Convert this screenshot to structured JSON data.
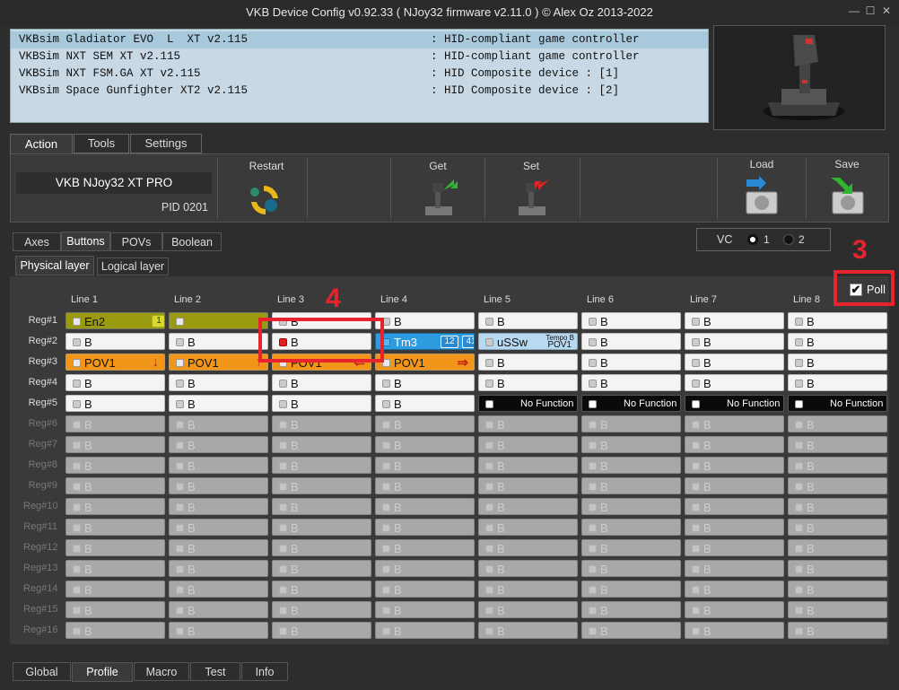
{
  "window": {
    "title": "VKB Device Config v0.92.33 ( NJoy32 firmware v2.11.0 ) © Alex Oz 2013-2022",
    "minimize": "—",
    "maximize": "☐",
    "close": "✕"
  },
  "devices": [
    {
      "name": "VKBsim Gladiator EVO  L  XT v2.115",
      "desc": ": HID-compliant game controller"
    },
    {
      "name": "VKBSim NXT SEM XT v2.115",
      "desc": ": HID-compliant game controller"
    },
    {
      "name": "VKBSim NXT FSM.GA XT v2.115",
      "desc": ": HID Composite device : [1]"
    },
    {
      "name": "VKBsim Space Gunfighter XT2 v2.115",
      "desc": ": HID Composite device : [2]"
    }
  ],
  "main_tabs": [
    "Action",
    "Tools",
    "Settings"
  ],
  "action": {
    "device_name": "VKB NJoy32 XT PRO",
    "pid": "PID 0201",
    "restart": "Restart",
    "get": "Get",
    "set": "Set",
    "load": "Load",
    "save": "Save"
  },
  "sub_tabs": [
    "Axes",
    "Buttons",
    "POVs",
    "Boolean"
  ],
  "vc": {
    "label": "VC",
    "opt1": "1",
    "opt2": "2",
    "selected": "1"
  },
  "layer_tabs": [
    "Physical layer",
    "Logical layer"
  ],
  "poll": {
    "label": "Poll",
    "checked": true
  },
  "lines": [
    "Line 1",
    "Line 2",
    "Line 3",
    "Line 4",
    "Line 5",
    "Line 6",
    "Line 7",
    "Line 8"
  ],
  "regs": [
    "Reg#1",
    "Reg#2",
    "Reg#3",
    "Reg#4",
    "Reg#5",
    "Reg#6",
    "Reg#7",
    "Reg#8",
    "Reg#9",
    "Reg#10",
    "Reg#11",
    "Reg#12",
    "Reg#13",
    "Reg#14",
    "Reg#15",
    "Reg#16"
  ],
  "grid": {
    "r1": [
      {
        "t": "En2",
        "c": "olive",
        "b": [
          "1"
        ]
      },
      {
        "t": "",
        "c": "olive"
      },
      {
        "t": "B",
        "c": "white"
      },
      {
        "t": "B",
        "c": "white"
      },
      {
        "t": "B",
        "c": "white"
      },
      {
        "t": "B",
        "c": "white"
      },
      {
        "t": "B",
        "c": "white"
      },
      {
        "t": "B",
        "c": "white"
      }
    ],
    "r2": [
      {
        "t": "B",
        "c": "white"
      },
      {
        "t": "B",
        "c": "white"
      },
      {
        "t": "B",
        "c": "white",
        "red": true
      },
      {
        "t": "Tm3",
        "c": "blue",
        "b": [
          "12",
          "41"
        ]
      },
      {
        "t": "uSSw",
        "c": "lblue",
        "sub": [
          "Tempo B",
          "POV1"
        ]
      },
      {
        "t": "B",
        "c": "white"
      },
      {
        "t": "B",
        "c": "white"
      },
      {
        "t": "B",
        "c": "white"
      }
    ],
    "r3": [
      {
        "t": "POV1",
        "c": "orange",
        "arrow": "↓"
      },
      {
        "t": "POV1",
        "c": "orange",
        "arrow": "↑"
      },
      {
        "t": "POV1",
        "c": "orange",
        "arrow": "⇐"
      },
      {
        "t": "POV1",
        "c": "orange",
        "arrow": "⇒"
      },
      {
        "t": "B",
        "c": "white"
      },
      {
        "t": "B",
        "c": "white"
      },
      {
        "t": "B",
        "c": "white"
      },
      {
        "t": "B",
        "c": "white"
      }
    ],
    "r4": [
      {
        "t": "B",
        "c": "white"
      },
      {
        "t": "B",
        "c": "white"
      },
      {
        "t": "B",
        "c": "white"
      },
      {
        "t": "B",
        "c": "white"
      },
      {
        "t": "B",
        "c": "white"
      },
      {
        "t": "B",
        "c": "white"
      },
      {
        "t": "B",
        "c": "white"
      },
      {
        "t": "B",
        "c": "white"
      }
    ],
    "r5": [
      {
        "t": "B",
        "c": "white"
      },
      {
        "t": "B",
        "c": "white"
      },
      {
        "t": "B",
        "c": "white"
      },
      {
        "t": "B",
        "c": "white"
      },
      {
        "t": "No Function",
        "c": "black"
      },
      {
        "t": "No Function",
        "c": "black"
      },
      {
        "t": "No Function",
        "c": "black"
      },
      {
        "t": "No Function",
        "c": "black"
      }
    ],
    "disabled_text": "B"
  },
  "bottom_tabs": [
    "Global",
    "Profile",
    "Macro",
    "Test",
    "Info"
  ],
  "annotations": {
    "a3": "3",
    "a4": "4"
  }
}
